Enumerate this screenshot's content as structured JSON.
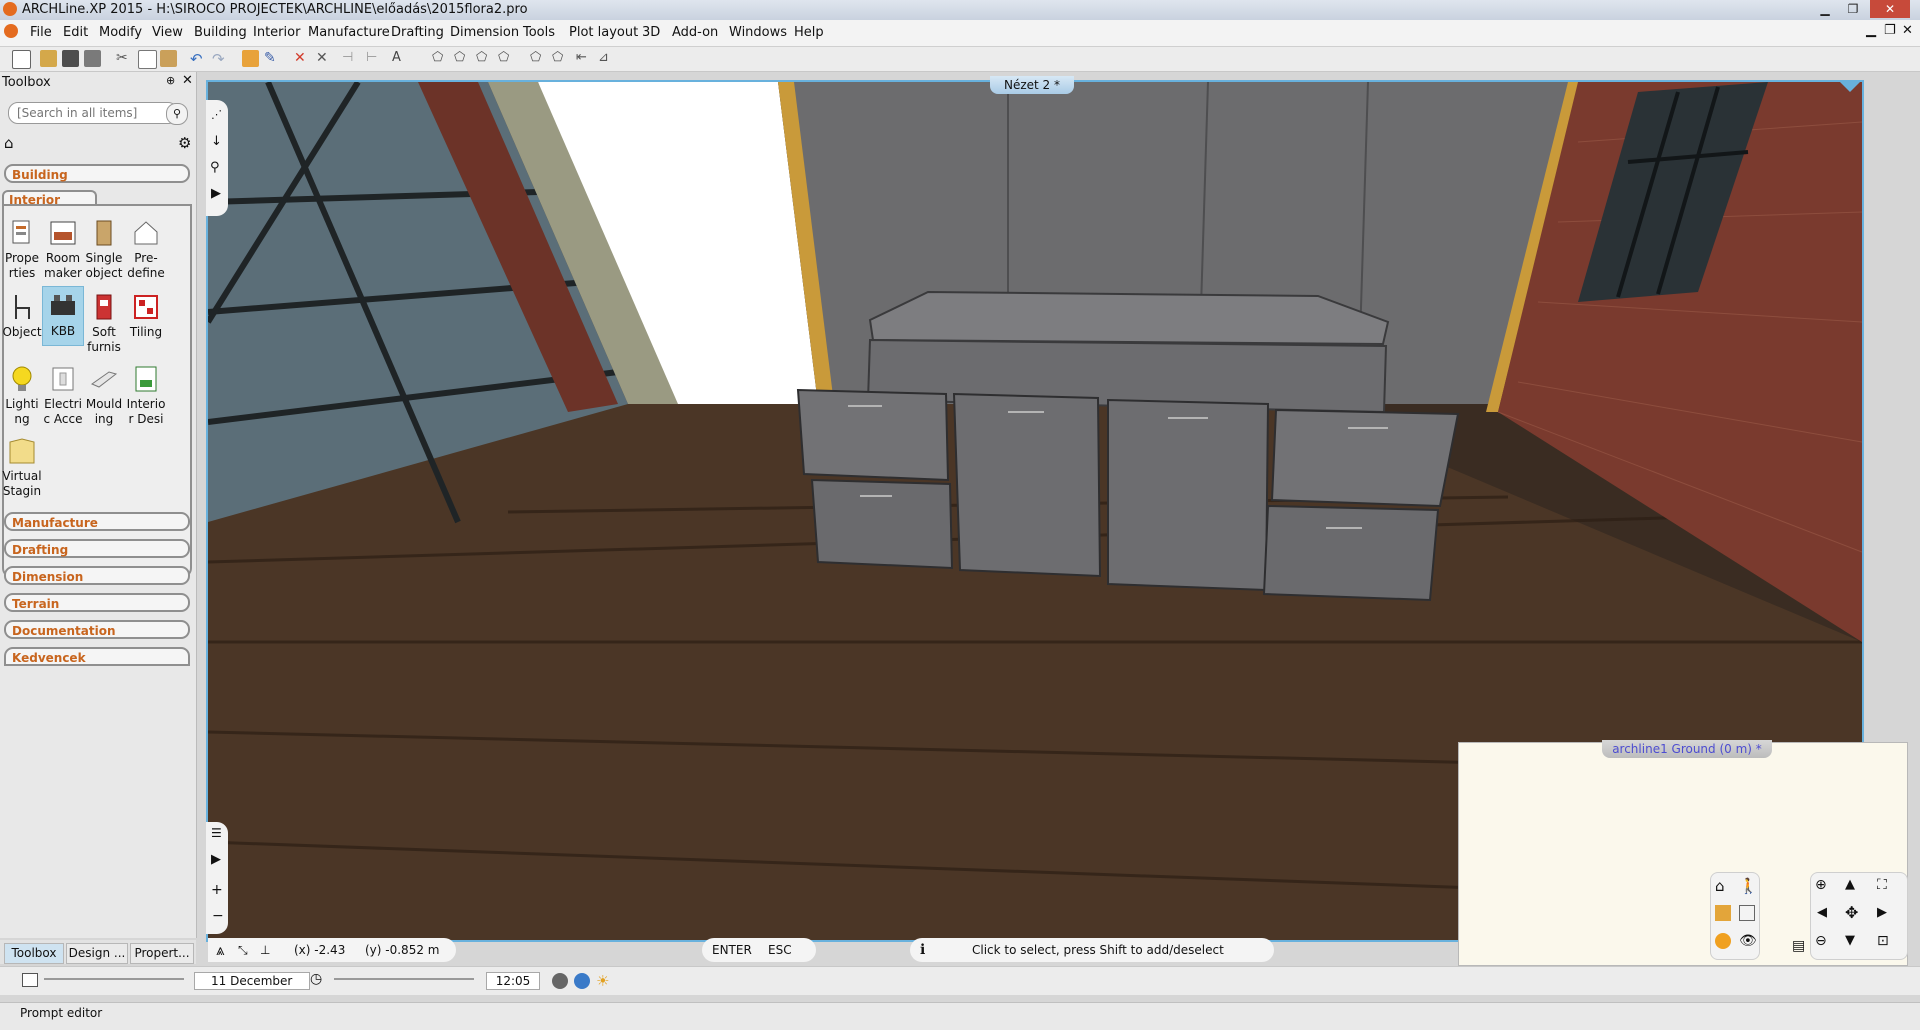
{
  "window": {
    "title": "ARCHLine.XP 2015 - H:\\SIROCO PROJECTEK\\ARCHLINE\\előadás\\2015flora2.pro"
  },
  "menu": [
    "File",
    "Edit",
    "Modify",
    "View",
    "Building",
    "Interior",
    "Manufacture",
    "Drafting",
    "Dimension",
    "Tools",
    "Plot layout",
    "3D",
    "Add-on",
    "Windows",
    "Help"
  ],
  "toolbox": {
    "title": "Toolbox",
    "search_placeholder": "[Search in all items]",
    "categories_top": [
      "Building"
    ],
    "active_category": "Interior",
    "tools": [
      {
        "label": "Prope rties",
        "icon": "properties-icon"
      },
      {
        "label": "Room maker",
        "icon": "room-maker-icon"
      },
      {
        "label": "Single object",
        "icon": "single-object-icon"
      },
      {
        "label": "Pre- define",
        "icon": "predefine-icon"
      },
      {
        "label": "Object",
        "icon": "chair-icon"
      },
      {
        "label": "KBB",
        "icon": "kbb-icon"
      },
      {
        "label": "Soft furnis",
        "icon": "soft-furnishing-icon"
      },
      {
        "label": "Tiling",
        "icon": "tiling-icon"
      },
      {
        "label": "Lighti ng",
        "icon": "lightbulb-icon"
      },
      {
        "label": "Electri c Acce",
        "icon": "electric-icon"
      },
      {
        "label": "Mould ing",
        "icon": "moulding-icon"
      },
      {
        "label": "Interio r Desi",
        "icon": "interior-design-icon"
      },
      {
        "label": "Virtual Stagin",
        "icon": "virtual-staging-icon"
      }
    ],
    "categories_bottom": [
      "Manufacture",
      "Drafting",
      "Dimension",
      "Terrain",
      "Documentation",
      "Kedvencek"
    ],
    "bottom_tabs": [
      "Toolbox",
      "Design ...",
      "Propert..."
    ]
  },
  "viewport": {
    "tab": "Nézet 2 *"
  },
  "status": {
    "coord_x": "(x) -2.43",
    "coord_y": "(y) -0.852 m",
    "enter": "ENTER",
    "esc": "ESC",
    "info_icon": "info-icon",
    "hint": "Click to select, press Shift to add/deselect"
  },
  "plan_window": {
    "tab": "archline1 Ground (0 m) *"
  },
  "timebar": {
    "date": "11 December",
    "time": "12:05"
  },
  "prompt": {
    "label": "Prompt editor"
  },
  "colors": {
    "accent": "#c8651e",
    "viewport_border": "#68b1dd",
    "plan_tab_text": "#4d4dd0"
  }
}
